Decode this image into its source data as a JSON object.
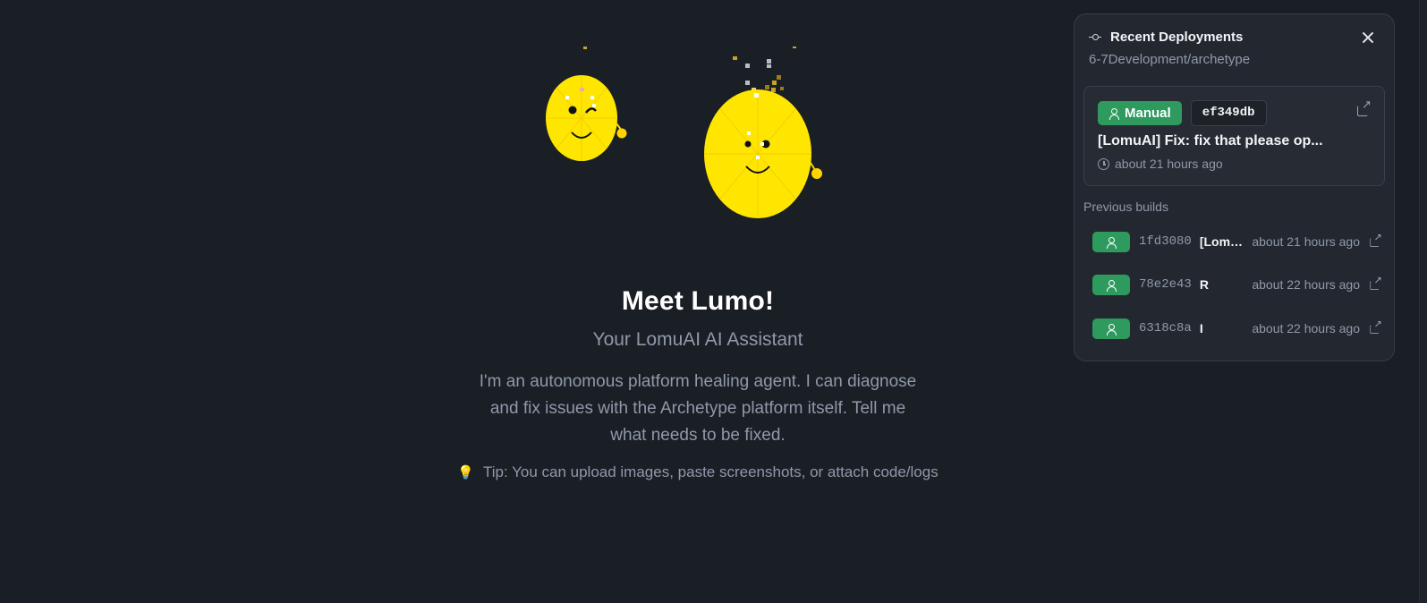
{
  "hero": {
    "title": "Meet Lumo!",
    "subtitle": "Your LomuAI AI Assistant",
    "description": "I'm an autonomous platform healing agent. I can diagnose and fix issues with the Archetype platform itself. Tell me what needs to be fixed.",
    "tip_icon": "💡",
    "tip": "Tip: You can upload images, paste screenshots, or attach code/logs"
  },
  "deployments": {
    "title": "Recent Deployments",
    "repo": "6-7Development/archetype",
    "latest": {
      "trigger": "Manual",
      "commit": "ef349db",
      "message": "[LomuAI] Fix: fix that please op...",
      "time": "about 21 hours ago"
    },
    "previous_label": "Previous builds",
    "builds": [
      {
        "commit": "1fd3080",
        "message": "[LomuAI] Fix",
        "time": "about 21 hours ago"
      },
      {
        "commit": "78e2e43",
        "message": "R",
        "time": "about 22 hours ago"
      },
      {
        "commit": "6318c8a",
        "message": "I",
        "time": "about 22 hours ago"
      }
    ]
  },
  "colors": {
    "background": "#1a1e25",
    "panel": "#232830",
    "badge_green": "#2e9a5e",
    "mascot_yellow": "#ffe600"
  }
}
